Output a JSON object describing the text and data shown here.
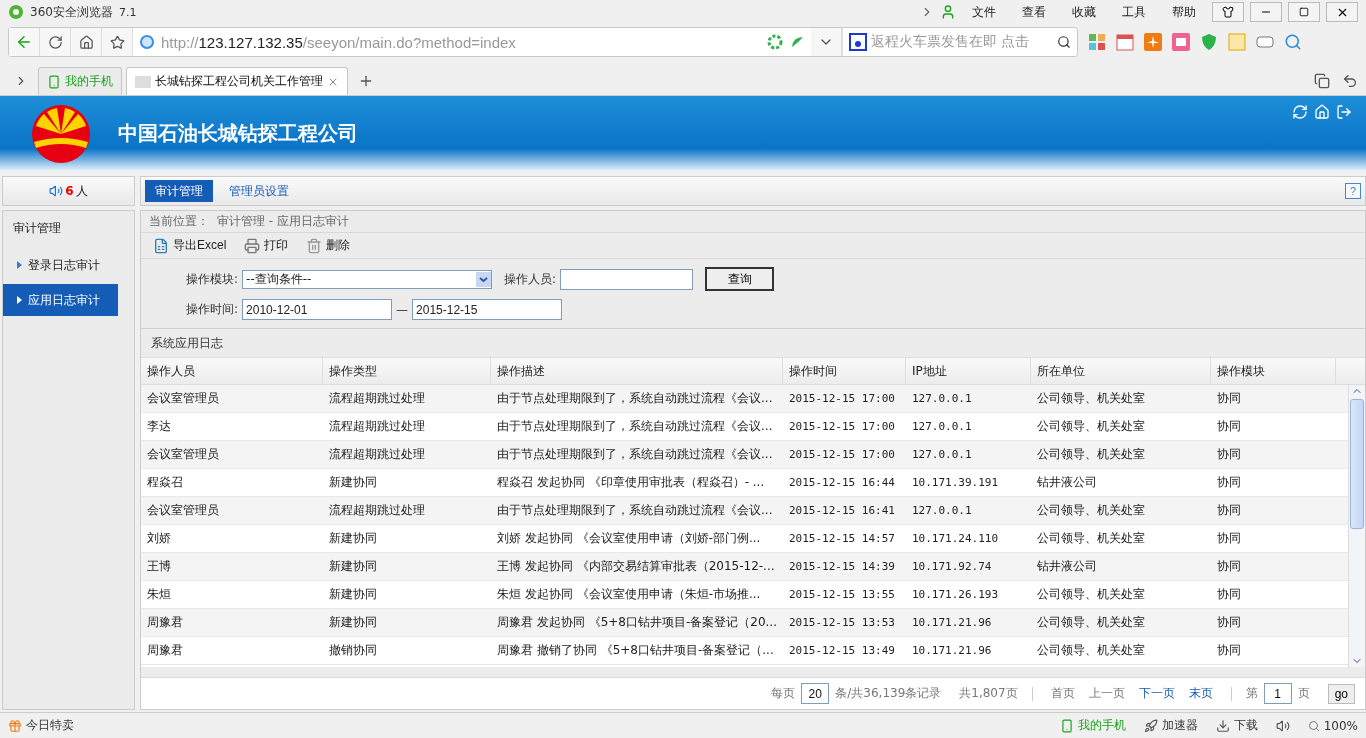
{
  "browser": {
    "title": "360安全浏览器",
    "version": "7.1",
    "menu": [
      "文件",
      "查看",
      "收藏",
      "工具",
      "帮助"
    ],
    "url_scheme": "http://",
    "url_host": "123.127.132.35",
    "url_path": "/seeyon/main.do?method=index",
    "search_placeholder": "返程火车票发售在即 点击",
    "tabs": [
      {
        "label": "我的手机",
        "kind": "phone",
        "selected": false
      },
      {
        "label": "长城钻探工程公司机关工作管理",
        "kind": "page",
        "selected": true
      }
    ]
  },
  "banner": {
    "company": "中国石油长城钻探工程公司"
  },
  "online": {
    "count": "6",
    "unit": "人"
  },
  "top_tabs": [
    {
      "label": "审计管理",
      "selected": true
    },
    {
      "label": "管理员设置",
      "selected": false
    }
  ],
  "help": "?",
  "sidebar": {
    "title": "审计管理",
    "items": [
      {
        "label": "登录日志审计",
        "selected": false
      },
      {
        "label": "应用日志审计",
        "selected": true
      }
    ]
  },
  "breadcrumb": {
    "label": "当前位置：",
    "path": "审计管理 - 应用日志审计"
  },
  "toolbar": [
    {
      "label": "导出Excel",
      "kind": "excel"
    },
    {
      "label": "打印",
      "kind": "print"
    },
    {
      "label": "删除",
      "kind": "delete"
    }
  ],
  "filters": {
    "module_label": "操作模块:",
    "module_value": "--查询条件--",
    "user_label": "操作人员:",
    "query_button": "查询",
    "time_label": "操作时间:",
    "time_from": "2010-12-01",
    "time_sep": "—",
    "time_to": "2015-12-15"
  },
  "section_title": "系统应用日志",
  "table": {
    "columns": [
      "操作人员",
      "操作类型",
      "操作描述",
      "操作时间",
      "IP地址",
      "所在单位",
      "操作模块"
    ],
    "rows": [
      [
        "会议室管理员",
        "流程超期跳过处理",
        "由于节点处理期限到了，系统自动跳过流程《会议...",
        "2015-12-15 17:00",
        "127.0.0.1",
        "公司领导、机关处室",
        "协同"
      ],
      [
        "李达",
        "流程超期跳过处理",
        "由于节点处理期限到了，系统自动跳过流程《会议...",
        "2015-12-15 17:00",
        "127.0.0.1",
        "公司领导、机关处室",
        "协同"
      ],
      [
        "会议室管理员",
        "流程超期跳过处理",
        "由于节点处理期限到了，系统自动跳过流程《会议...",
        "2015-12-15 17:00",
        "127.0.0.1",
        "公司领导、机关处室",
        "协同"
      ],
      [
        "程焱召",
        "新建协同",
        "程焱召 发起协同 《印章使用审批表（程焱召）- ...",
        "2015-12-15 16:44",
        "10.171.39.191",
        "钻井液公司",
        "协同"
      ],
      [
        "会议室管理员",
        "流程超期跳过处理",
        "由于节点处理期限到了，系统自动跳过流程《会议...",
        "2015-12-15 16:41",
        "127.0.0.1",
        "公司领导、机关处室",
        "协同"
      ],
      [
        "刘娇",
        "新建协同",
        "刘娇 发起协同 《会议室使用申请（刘娇-部门例...",
        "2015-12-15 14:57",
        "10.171.24.110",
        "公司领导、机关处室",
        "协同"
      ],
      [
        "王博",
        "新建协同",
        "王博 发起协同 《内部交易结算审批表（2015-12-...",
        "2015-12-15 14:39",
        "10.171.92.74",
        "钻井液公司",
        "协同"
      ],
      [
        "朱烜",
        "新建协同",
        "朱烜 发起协同 《会议室使用申请（朱烜-市场推...",
        "2015-12-15 13:55",
        "10.171.26.193",
        "公司领导、机关处室",
        "协同"
      ],
      [
        "周豫君",
        "新建协同",
        "周豫君 发起协同 《5+8口钻井项目-备案登记（20...",
        "2015-12-15 13:53",
        "10.171.21.96",
        "公司领导、机关处室",
        "协同"
      ],
      [
        "周豫君",
        "撤销协同",
        "周豫君 撤销了协同 《5+8口钻井项目-备案登记（...",
        "2015-12-15 13:49",
        "10.171.21.96",
        "公司领导、机关处室",
        "协同"
      ]
    ]
  },
  "pager": {
    "per_page_label": "每页",
    "per_page": "20",
    "total_records": "条/共36,139条记录",
    "total_pages": "共1,807页",
    "links": [
      {
        "label": "首页",
        "disabled": true
      },
      {
        "label": "上一页",
        "disabled": true
      },
      {
        "label": "下一页",
        "disabled": false
      },
      {
        "label": "末页",
        "disabled": false
      }
    ],
    "page_prefix": "第",
    "page": "1",
    "page_suffix": "页",
    "go": "go"
  },
  "status_bar": {
    "left": "今日特卖",
    "phone": "我的手机",
    "speed": "加速器",
    "download": "下载",
    "zoom": "100%"
  }
}
